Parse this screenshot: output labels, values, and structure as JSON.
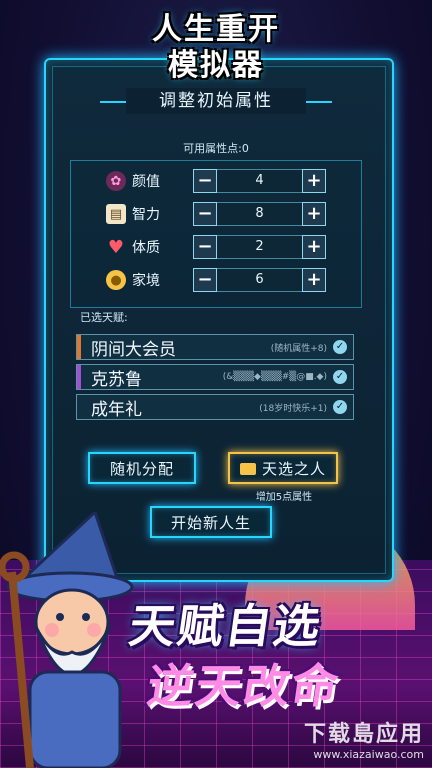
{
  "title": {
    "line1": "人生重开",
    "line2": "模拟器"
  },
  "subtitle": "调整初始属性",
  "points_available": "可用属性点:0",
  "attributes": [
    {
      "icon": "bow-icon",
      "label": "颜值",
      "value": "4",
      "minus": "−",
      "plus": "+"
    },
    {
      "icon": "book-icon",
      "label": "智力",
      "value": "8",
      "minus": "−",
      "plus": "+"
    },
    {
      "icon": "heart-icon",
      "label": "体质",
      "value": "2",
      "minus": "−",
      "plus": "+"
    },
    {
      "icon": "coin-icon",
      "label": "家境",
      "value": "6",
      "minus": "−",
      "plus": "+"
    }
  ],
  "talents_heading": "已选天赋:",
  "talents": [
    {
      "name": "阴间大会员",
      "desc": "(随机属性+8)",
      "color": "#e0772e"
    },
    {
      "name": "克苏鲁",
      "desc": "(&▒▒▒◆▒▒▒#▒@■.◆)",
      "color": "#a34fd1"
    },
    {
      "name": "成年礼",
      "desc": "(18岁时快乐+1)",
      "color": "#7fb3c8"
    }
  ],
  "buttons": {
    "random": "随机分配",
    "chosen": "天选之人",
    "chosen_note": "增加5点属性",
    "start": "开始新人生"
  },
  "slogan": {
    "line1": "天赋自选",
    "line2": "逆天改命"
  },
  "watermark": {
    "line1": "下载島应用",
    "line2": "www.xiazaiwao.com"
  },
  "colors": {
    "accent": "#26d6ff",
    "gold": "#f5c447",
    "panel": "#0c2232"
  }
}
